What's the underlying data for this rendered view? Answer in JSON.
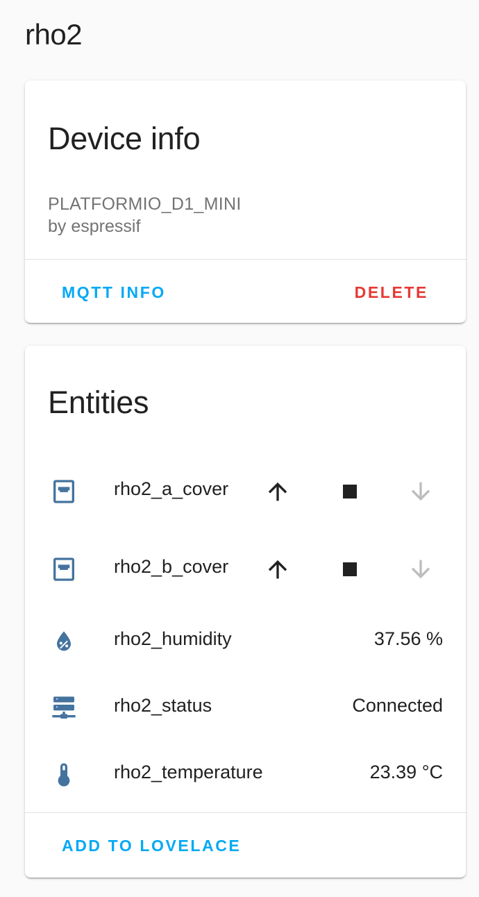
{
  "page": {
    "title": "rho2"
  },
  "device_info": {
    "header": "Device info",
    "model": "PLATFORMIO_D1_MINI",
    "manufacturer": "by espressif",
    "actions": {
      "mqtt_info": "MQTT INFO",
      "delete": "DELETE"
    }
  },
  "entities": {
    "header": "Entities",
    "rows": [
      {
        "name": "rho2_a_cover",
        "icon": "window-shutter-icon",
        "type": "cover"
      },
      {
        "name": "rho2_b_cover",
        "icon": "window-shutter-icon",
        "type": "cover"
      },
      {
        "name": "rho2_humidity",
        "icon": "water-percent-icon",
        "state": "37.56 %"
      },
      {
        "name": "rho2_status",
        "icon": "server-network-icon",
        "state": "Connected"
      },
      {
        "name": "rho2_temperature",
        "icon": "thermometer-icon",
        "state": "23.39 °C"
      }
    ],
    "actions": {
      "add_to_lovelace": "ADD TO LOVELACE"
    }
  },
  "colors": {
    "primary": "#03a9f4",
    "danger": "#e53935",
    "icon": "#44739e",
    "disabled": "#bdbdbd"
  }
}
